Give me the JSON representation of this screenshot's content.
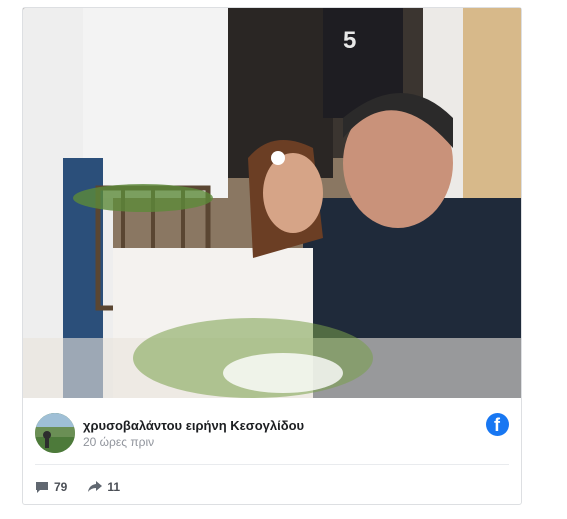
{
  "post": {
    "author_name": "χρυσοβαλάντου ειρήνη Κεσογλίδου",
    "time": "20 ώρες πριν",
    "comments_count": "79",
    "shares_count": "11"
  },
  "icons": {
    "brand": "facebook-icon",
    "comment": "comment-icon",
    "share": "share-icon"
  },
  "colors": {
    "facebook_blue": "#1877f2",
    "text_dark": "#1c1e21",
    "text_muted": "#90949c"
  }
}
